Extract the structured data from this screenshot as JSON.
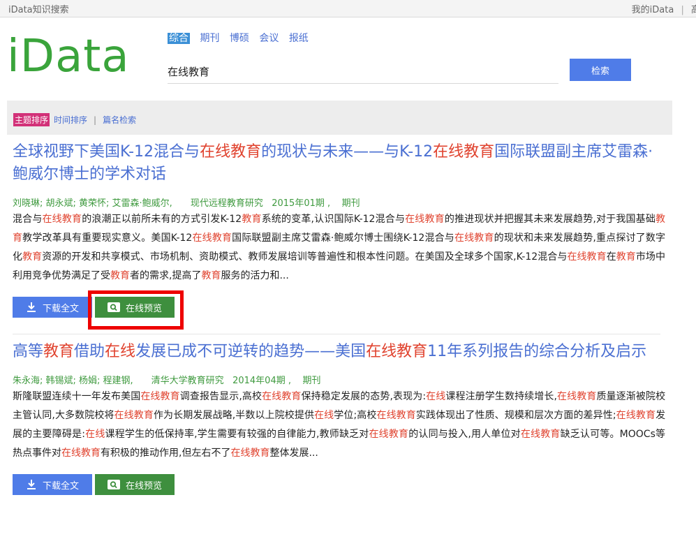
{
  "topbar": {
    "site_name": "iData知识搜索",
    "my_link": "我的iData",
    "separator": "|",
    "cut_link": "高"
  },
  "logo": {
    "text": "iData"
  },
  "tabs": [
    {
      "label": "综合",
      "active": true
    },
    {
      "label": "期刊",
      "active": false
    },
    {
      "label": "博硕",
      "active": false
    },
    {
      "label": "会议",
      "active": false
    },
    {
      "label": "报纸",
      "active": false
    }
  ],
  "search": {
    "value": "在线教育",
    "button_label": "检索"
  },
  "sort": {
    "active_label": "主题排序",
    "time_label": "时间排序",
    "separator": "|",
    "title_search_label": "篇名检索"
  },
  "buttons": {
    "download": "下载全文",
    "preview": "在线预览"
  },
  "results": [
    {
      "title": [
        {
          "t": "全球视野下美国K-12混合与",
          "h": false
        },
        {
          "t": "在线教育",
          "h": true
        },
        {
          "t": "的现状与未来——与K-12",
          "h": false
        },
        {
          "t": "在线教育",
          "h": true
        },
        {
          "t": "国际联盟副主席艾雷森·鲍威尔博士的学术对话",
          "h": false
        }
      ],
      "authors": "刘晓琳; 胡永斌; 黄荣怀; 艾雷森·鲍威尔,",
      "journal": "现代远程教育研究",
      "issue": "2015年01期 ,",
      "type": "期刊",
      "abstract": [
        {
          "t": "混合与",
          "h": false
        },
        {
          "t": "在线教育",
          "h": true
        },
        {
          "t": "的浪潮正以前所未有的方式引发K-12",
          "h": false
        },
        {
          "t": "教育",
          "h": true
        },
        {
          "t": "系统的变革,认识国际K-12混合与",
          "h": false
        },
        {
          "t": "在线教育",
          "h": true
        },
        {
          "t": "的推进现状并把握其未来发展趋势,对于我国基础",
          "h": false
        },
        {
          "t": "教育",
          "h": true
        },
        {
          "t": "教学改革具有重要现实意义。美国K-12",
          "h": false
        },
        {
          "t": "在线教育",
          "h": true
        },
        {
          "t": "国际联盟副主席艾雷森·鲍威尔博士围绕K-12混合与",
          "h": false
        },
        {
          "t": "在线教育",
          "h": true
        },
        {
          "t": "的现状和未来发展趋势,重点探讨了数字化",
          "h": false
        },
        {
          "t": "教育",
          "h": true
        },
        {
          "t": "资源的开发和共享模式、市场机制、资助模式、教师发展培训等普遍性和根本性问题。在美国及全球多个国家,K-12混合与",
          "h": false
        },
        {
          "t": "在线教育",
          "h": true
        },
        {
          "t": "在",
          "h": false
        },
        {
          "t": "教育",
          "h": true
        },
        {
          "t": "市场中利用竞争优势满足了受",
          "h": false
        },
        {
          "t": "教育",
          "h": true
        },
        {
          "t": "者的需求,提高了",
          "h": false
        },
        {
          "t": "教育",
          "h": true
        },
        {
          "t": "服务的活力和...",
          "h": false
        }
      ]
    },
    {
      "title": [
        {
          "t": "高等",
          "h": false
        },
        {
          "t": "教育",
          "h": true
        },
        {
          "t": "借助",
          "h": false
        },
        {
          "t": "在线",
          "h": true
        },
        {
          "t": "发展已成不可逆转的趋势——美国",
          "h": false
        },
        {
          "t": "在线教育",
          "h": true
        },
        {
          "t": "11年系列报告的综合分析及启示",
          "h": false
        }
      ],
      "authors": "朱永海; 韩锡斌; 杨娟; 程建钢,",
      "journal": "清华大学教育研究",
      "issue": "2014年04期 ,",
      "type": "期刊",
      "abstract": [
        {
          "t": "斯隆联盟连续十一年发布美国",
          "h": false
        },
        {
          "t": "在线教育",
          "h": true
        },
        {
          "t": "调查报告显示,高校",
          "h": false
        },
        {
          "t": "在线教育",
          "h": true
        },
        {
          "t": "保持稳定发展的态势,表现为:",
          "h": false
        },
        {
          "t": "在线",
          "h": true
        },
        {
          "t": "课程注册学生数持续增长,",
          "h": false
        },
        {
          "t": "在线教育",
          "h": true
        },
        {
          "t": "质量逐渐被院校主管认同,大多数院校将",
          "h": false
        },
        {
          "t": "在线教育",
          "h": true
        },
        {
          "t": "作为长期发展战略,半数以上院校提供",
          "h": false
        },
        {
          "t": "在线",
          "h": true
        },
        {
          "t": "学位;高校",
          "h": false
        },
        {
          "t": "在线教育",
          "h": true
        },
        {
          "t": "实践体现出了性质、规模和层次方面的差异性;",
          "h": false
        },
        {
          "t": "在线教育",
          "h": true
        },
        {
          "t": "发展的主要障碍是:",
          "h": false
        },
        {
          "t": "在线",
          "h": true
        },
        {
          "t": "课程学生的低保持率,学生需要有较强的自律能力,教师缺乏对",
          "h": false
        },
        {
          "t": "在线教育",
          "h": true
        },
        {
          "t": "的认同与投入,用人单位对",
          "h": false
        },
        {
          "t": "在线教育",
          "h": true
        },
        {
          "t": "缺乏认可等。MOOCs等热点事件对",
          "h": false
        },
        {
          "t": "在线教育",
          "h": true
        },
        {
          "t": "有积极的推动作用,但左右不了",
          "h": false
        },
        {
          "t": "在线教育",
          "h": true
        },
        {
          "t": "整体发展...",
          "h": false
        }
      ]
    }
  ]
}
